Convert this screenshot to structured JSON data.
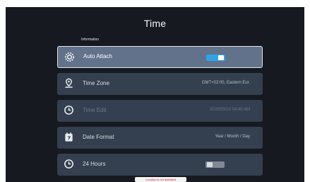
{
  "window": {
    "title": "Time"
  },
  "section": {
    "label": "Information"
  },
  "settings": [
    {
      "label": "Auto Attach",
      "value": "",
      "icon": "gear-icon",
      "control": "toggle",
      "toggle_on": true
    },
    {
      "label": "Time Zone",
      "value": "GMT+02:00, Eastern Eur.",
      "icon": "location-pin-icon"
    },
    {
      "label": "Time Edit",
      "value": "2020/03/10 04:40 AM",
      "icon": "clock-icon"
    },
    {
      "label": "Date Format",
      "value": "Year / Month / Day",
      "icon": "calendar-icon"
    },
    {
      "label": "24 Hours",
      "value": "",
      "icon": "clock-icon",
      "control": "toggle",
      "toggle_on": false
    }
  ],
  "toast": {
    "text": "Location is not activated"
  },
  "colors": {
    "background": "#16191f",
    "row": "#343f4f",
    "row_focused": "#62728a",
    "toggle_on": "#2ea4e6",
    "toast_text": "#d11d1d"
  }
}
